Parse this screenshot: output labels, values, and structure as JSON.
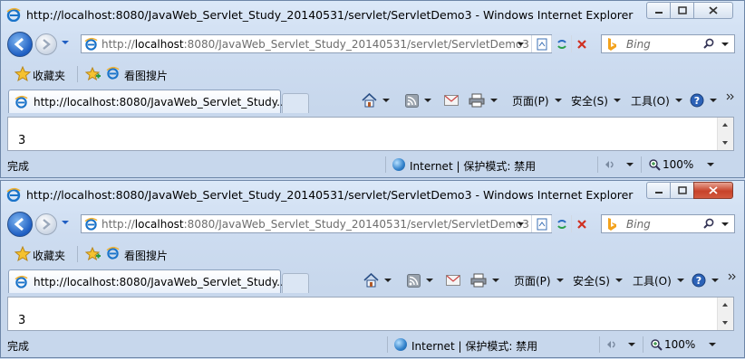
{
  "windows": [
    {
      "title": "http://localhost:8080/JavaWeb_Servlet_Study_20140531/servlet/ServletDemo3 - Windows Internet Explorer",
      "active": false,
      "address": {
        "scheme": "http://",
        "host": "localhost",
        "rest": ":8080/JavaWeb_Servlet_Study_20140531/servlet/ServletDemo3"
      },
      "search_placeholder": "Bing",
      "favorites_label": "收藏夹",
      "favorites_link": "看图搜片",
      "tab_title": "http://localhost:8080/JavaWeb_Servlet_Study...",
      "commands": {
        "page": "页面(P)",
        "safety": "安全(S)",
        "tools": "工具(O)"
      },
      "content_text": "3",
      "status_text": "完成",
      "zone_text": "Internet | 保护模式: 禁用",
      "zoom": "100%"
    },
    {
      "title": "http://localhost:8080/JavaWeb_Servlet_Study_20140531/servlet/ServletDemo3 - Windows Internet Explorer",
      "active": true,
      "address": {
        "scheme": "http://",
        "host": "localhost",
        "rest": ":8080/JavaWeb_Servlet_Study_20140531/servlet/ServletDemo3"
      },
      "search_placeholder": "Bing",
      "favorites_label": "收藏夹",
      "favorites_link": "看图搜片",
      "tab_title": "http://localhost:8080/JavaWeb_Servlet_Study...",
      "commands": {
        "page": "页面(P)",
        "safety": "安全(S)",
        "tools": "工具(O)"
      },
      "content_text": "3",
      "status_text": "完成",
      "zone_text": "Internet | 保护模式: 禁用",
      "zoom": "100%"
    }
  ],
  "colors": {
    "close_active": "#c7432a",
    "frame": "#cddcf0",
    "accent": "#1e5ec2"
  }
}
